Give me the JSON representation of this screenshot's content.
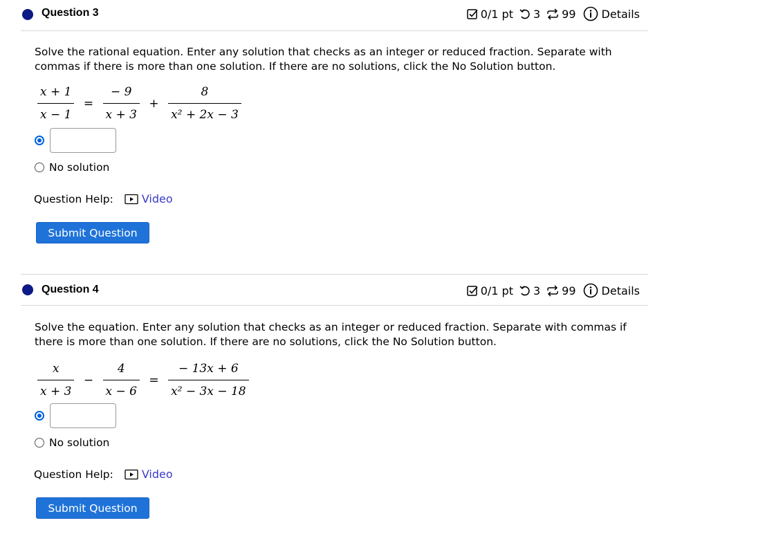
{
  "questions": [
    {
      "title": "Question 3",
      "score": "0/1 pt",
      "retries": "3",
      "attempts": "99",
      "details_label": "Details",
      "prompt": "Solve the rational equation. Enter any solution that checks as an integer or reduced fraction. Separate with commas if there is more than one solution. If there are no solutions, click the No Solution button.",
      "equation": {
        "lhs": {
          "num": "x + 1",
          "den": "x − 1"
        },
        "op1": "=",
        "t1": {
          "num": "− 9",
          "den": "x + 3"
        },
        "op2": "+",
        "t2": {
          "num": "8",
          "den": "x² + 2x − 3"
        }
      },
      "answer_value": "",
      "no_solution_label": "No solution",
      "help_label": "Question Help:",
      "video_label": "Video",
      "submit_label": "Submit Question"
    },
    {
      "title": "Question 4",
      "score": "0/1 pt",
      "retries": "3",
      "attempts": "99",
      "details_label": "Details",
      "prompt": "Solve the equation. Enter any solution that checks as an integer or reduced fraction. Separate with commas if there is more than one solution. If there are no solutions, click the No Solution button.",
      "equation": {
        "lhs": {
          "num": "x",
          "den": "x + 3"
        },
        "op1": "−",
        "t1": {
          "num": "4",
          "den": "x − 6"
        },
        "op2": "=",
        "t2": {
          "num": "− 13x + 6",
          "den": "x² − 3x − 18"
        }
      },
      "answer_value": "",
      "no_solution_label": "No solution",
      "help_label": "Question Help:",
      "video_label": "Video",
      "submit_label": "Submit Question"
    }
  ],
  "colors": {
    "dot": "#0d1a86",
    "accent": "#1f73d8",
    "link": "#3a3ac8"
  }
}
